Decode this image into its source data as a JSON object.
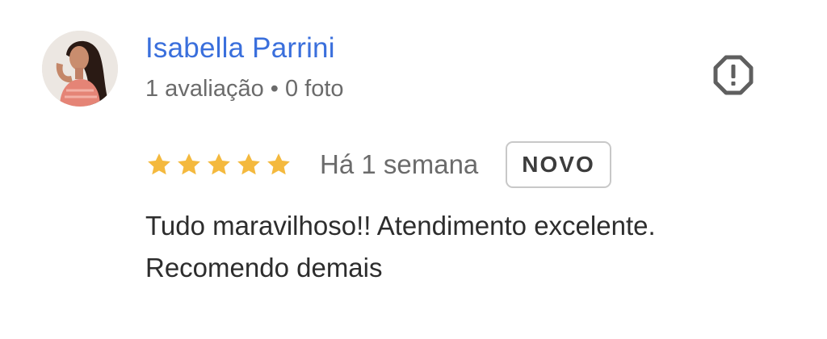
{
  "review": {
    "author_name": "Isabella Parrini",
    "author_meta": "1 avaliação • 0 foto",
    "rating": 5,
    "rating_max": 5,
    "date": "Há 1 semana",
    "badge": "NOVO",
    "text": "Tudo maravilhoso!! Atendimento excelente. Recomendo demais"
  },
  "colors": {
    "author_name": "#3a6fdc",
    "star": "#f4b93e",
    "meta_text": "#6b6b6b",
    "body_text": "#2d2d2d",
    "report_icon": "#5f5f5f"
  },
  "icons": {
    "avatar": "avatar",
    "report": "report-octagon-icon",
    "star": "star-icon"
  }
}
